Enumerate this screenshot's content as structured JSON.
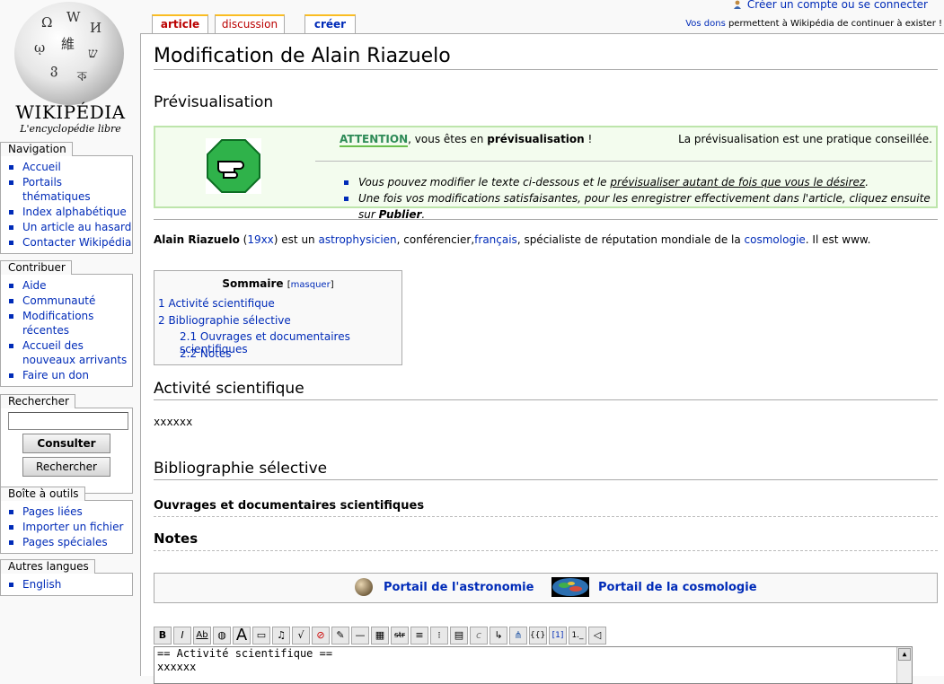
{
  "logo": {
    "word": "WIKIPÉDIA",
    "tagline": "L'encyclopédie libre"
  },
  "top": {
    "personal_link": "Créer un compte ou se connecter",
    "donate_link": "Vos dons",
    "donate_text": " permettent à Wikipédia de continuer à exister !"
  },
  "tabs": {
    "article": "article",
    "discussion": "discussion",
    "creer": "créer"
  },
  "sidebar": {
    "navigation": {
      "title": "Navigation",
      "items": [
        "Accueil",
        "Portails thématiques",
        "Index alphabétique",
        "Un article au hasard",
        "Contacter Wikipédia"
      ]
    },
    "contribuer": {
      "title": "Contribuer",
      "items": [
        "Aide",
        "Communauté",
        "Modifications récentes",
        "Accueil des nouveaux arrivants",
        "Faire un don"
      ]
    },
    "search": {
      "title": "Rechercher",
      "button_go": "Consulter",
      "button_search": "Rechercher"
    },
    "toolbox": {
      "title": "Boîte à outils",
      "items": [
        "Pages liées",
        "Importer un fichier",
        "Pages spéciales"
      ]
    },
    "languages": {
      "title": "Autres langues",
      "items": [
        "English"
      ]
    }
  },
  "page": {
    "title": "Modification de Alain Riazuelo",
    "preview_heading": "Prévisualisation",
    "preview": {
      "attention": "ATTENTION",
      "line_mid": ", vous êtes en ",
      "line_bold": "prévisualisation",
      "line_end": " !",
      "right_note": "La prévisualisation est une pratique conseillée.",
      "bullet1_a": "Vous pouvez modifier le texte ci-dessous et le ",
      "bullet1_link": "prévisualiser autant de fois que vous le désirez",
      "bullet1_b": ".",
      "bullet2_a": "Une fois vos modifications satisfaisantes, pour les enregistrer effectivement dans l'article, cliquez ensuite sur ",
      "bullet2_bold": "Publier",
      "bullet2_b": "."
    },
    "intro": {
      "name": "Alain Riazuelo",
      "t1": " (",
      "link_year": "19xx",
      "t2": ") est un ",
      "link_astro": "astrophysicien",
      "t3": ", conférencier,",
      "link_fr": "français",
      "t4": ", spécialiste de réputation mondiale de la ",
      "link_cosmo": "cosmologie",
      "t5": ". Il est www."
    },
    "toc": {
      "title": "Sommaire",
      "toggle": "masquer",
      "items": [
        "1 Activité scientifique",
        "2 Bibliographie sélective",
        "2.1 Ouvrages et documentaires scientifiques",
        "2.2 Notes"
      ]
    },
    "sections": {
      "s1": "Activité scientifique",
      "s1_text": "xxxxxx",
      "s2": "Bibliographie sélective",
      "s21": "Ouvrages et documentaires scientifiques",
      "s22": "Notes"
    },
    "portals": [
      "Portail de l'astronomie",
      "Portail de la cosmologie"
    ],
    "editor_lines": [
      "== Activité scientifique ==",
      "xxxxxx"
    ]
  },
  "colors": {
    "link": "#002bb8",
    "tab_border": "#fabd23",
    "preview_bg": "#f3fcee",
    "preview_border": "#bde5ab"
  }
}
